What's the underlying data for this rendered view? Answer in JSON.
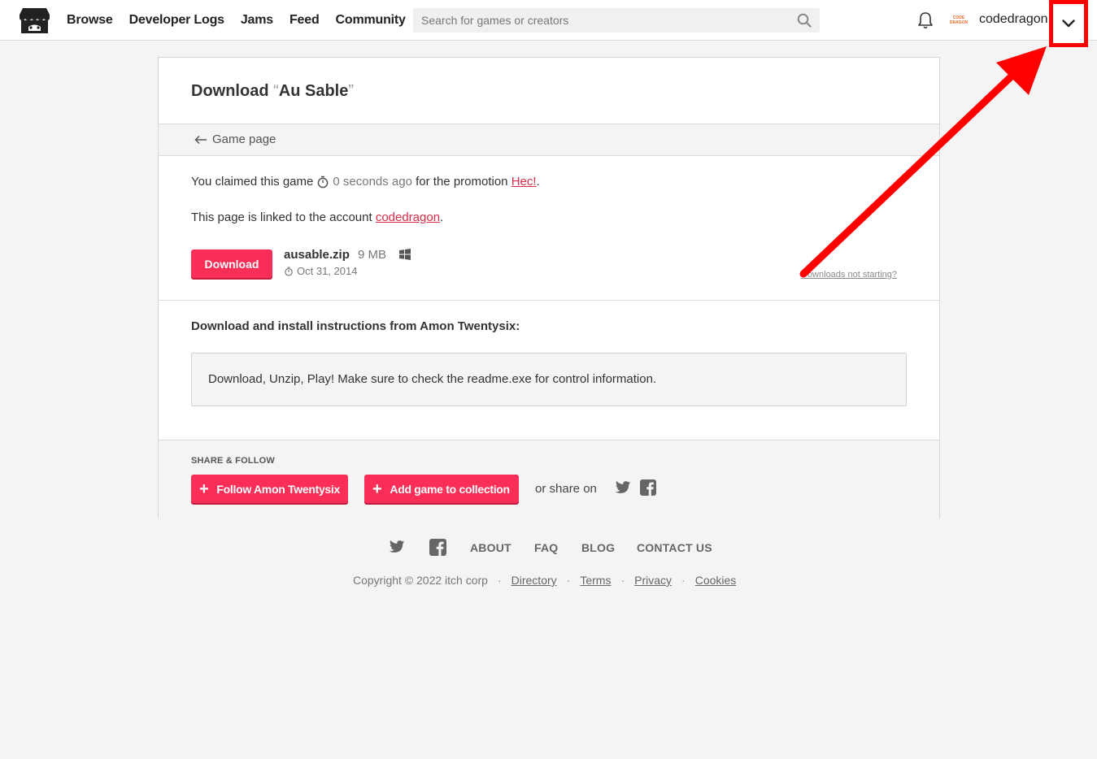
{
  "header": {
    "nav": [
      "Browse",
      "Developer Logs",
      "Jams",
      "Feed",
      "Community"
    ],
    "search_placeholder": "Search for games or creators",
    "avatar_text": [
      "CODE",
      "DRAGON"
    ],
    "username": "codedragon",
    "icons": [
      "itchio-logo-icon",
      "search-icon",
      "bell-icon",
      "chevron-down-icon"
    ]
  },
  "page": {
    "title_prefix": "Download ",
    "open_quote": "“",
    "game_title": "Au Sable",
    "close_quote": "”",
    "back_link": "Game page",
    "claim_prefix": "You claimed this game",
    "claim_time": "0 seconds ago",
    "claim_mid": "for the promotion",
    "promotion": "Hec!",
    "claim_end": ".",
    "linked_prefix": "This page is linked to the account",
    "linked_account": "codedragon",
    "linked_end": ".",
    "download_button": "Download",
    "file_name": "ausable.zip",
    "file_size": "9 MB",
    "file_date": "Oct 31, 2014",
    "not_starting": "Downloads not starting?",
    "instructions_title": "Download and install instructions from Amon Twentysix:",
    "instructions_text": "Download, Unzip, Play! Make sure to check the readme.exe for control information."
  },
  "share": {
    "label": "SHARE & FOLLOW",
    "follow_button": "Follow Amon Twentysix",
    "collection_button": "Add game to collection",
    "share_on": "or share on"
  },
  "footer": {
    "links": [
      "ABOUT",
      "FAQ",
      "BLOG",
      "CONTACT US"
    ],
    "copyright": "Copyright © 2022 itch corp",
    "legal_links": [
      "Directory",
      "Terms",
      "Privacy",
      "Cookies"
    ],
    "separator": "·"
  },
  "colors": {
    "accent": "#fa2e56",
    "link": "#da2c49",
    "annotation": "#ff0000"
  }
}
